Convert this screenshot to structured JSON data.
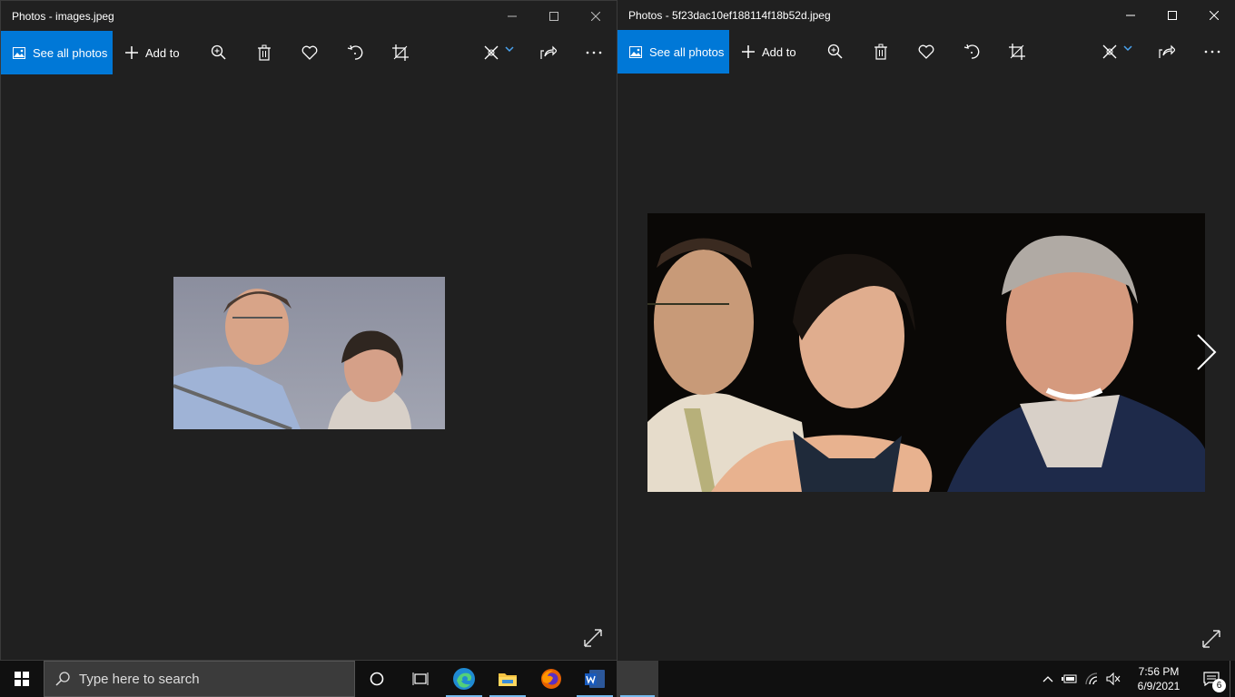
{
  "left_window": {
    "title": "Photos - images.jpeg",
    "toolbar": {
      "see_all_label": "See all photos",
      "add_to_label": "Add to"
    }
  },
  "right_window": {
    "title": "Photos - 5f23dac10ef188114f18b52d.jpeg",
    "toolbar": {
      "see_all_label": "See all photos",
      "add_to_label": "Add to"
    }
  },
  "taskbar": {
    "search_placeholder": "Type here to search",
    "clock_time": "7:56 PM",
    "clock_date": "6/9/2021",
    "notification_count": "6"
  },
  "colors": {
    "accent": "#0078d7",
    "window_bg": "#202020",
    "taskbar_bg": "#101010"
  }
}
